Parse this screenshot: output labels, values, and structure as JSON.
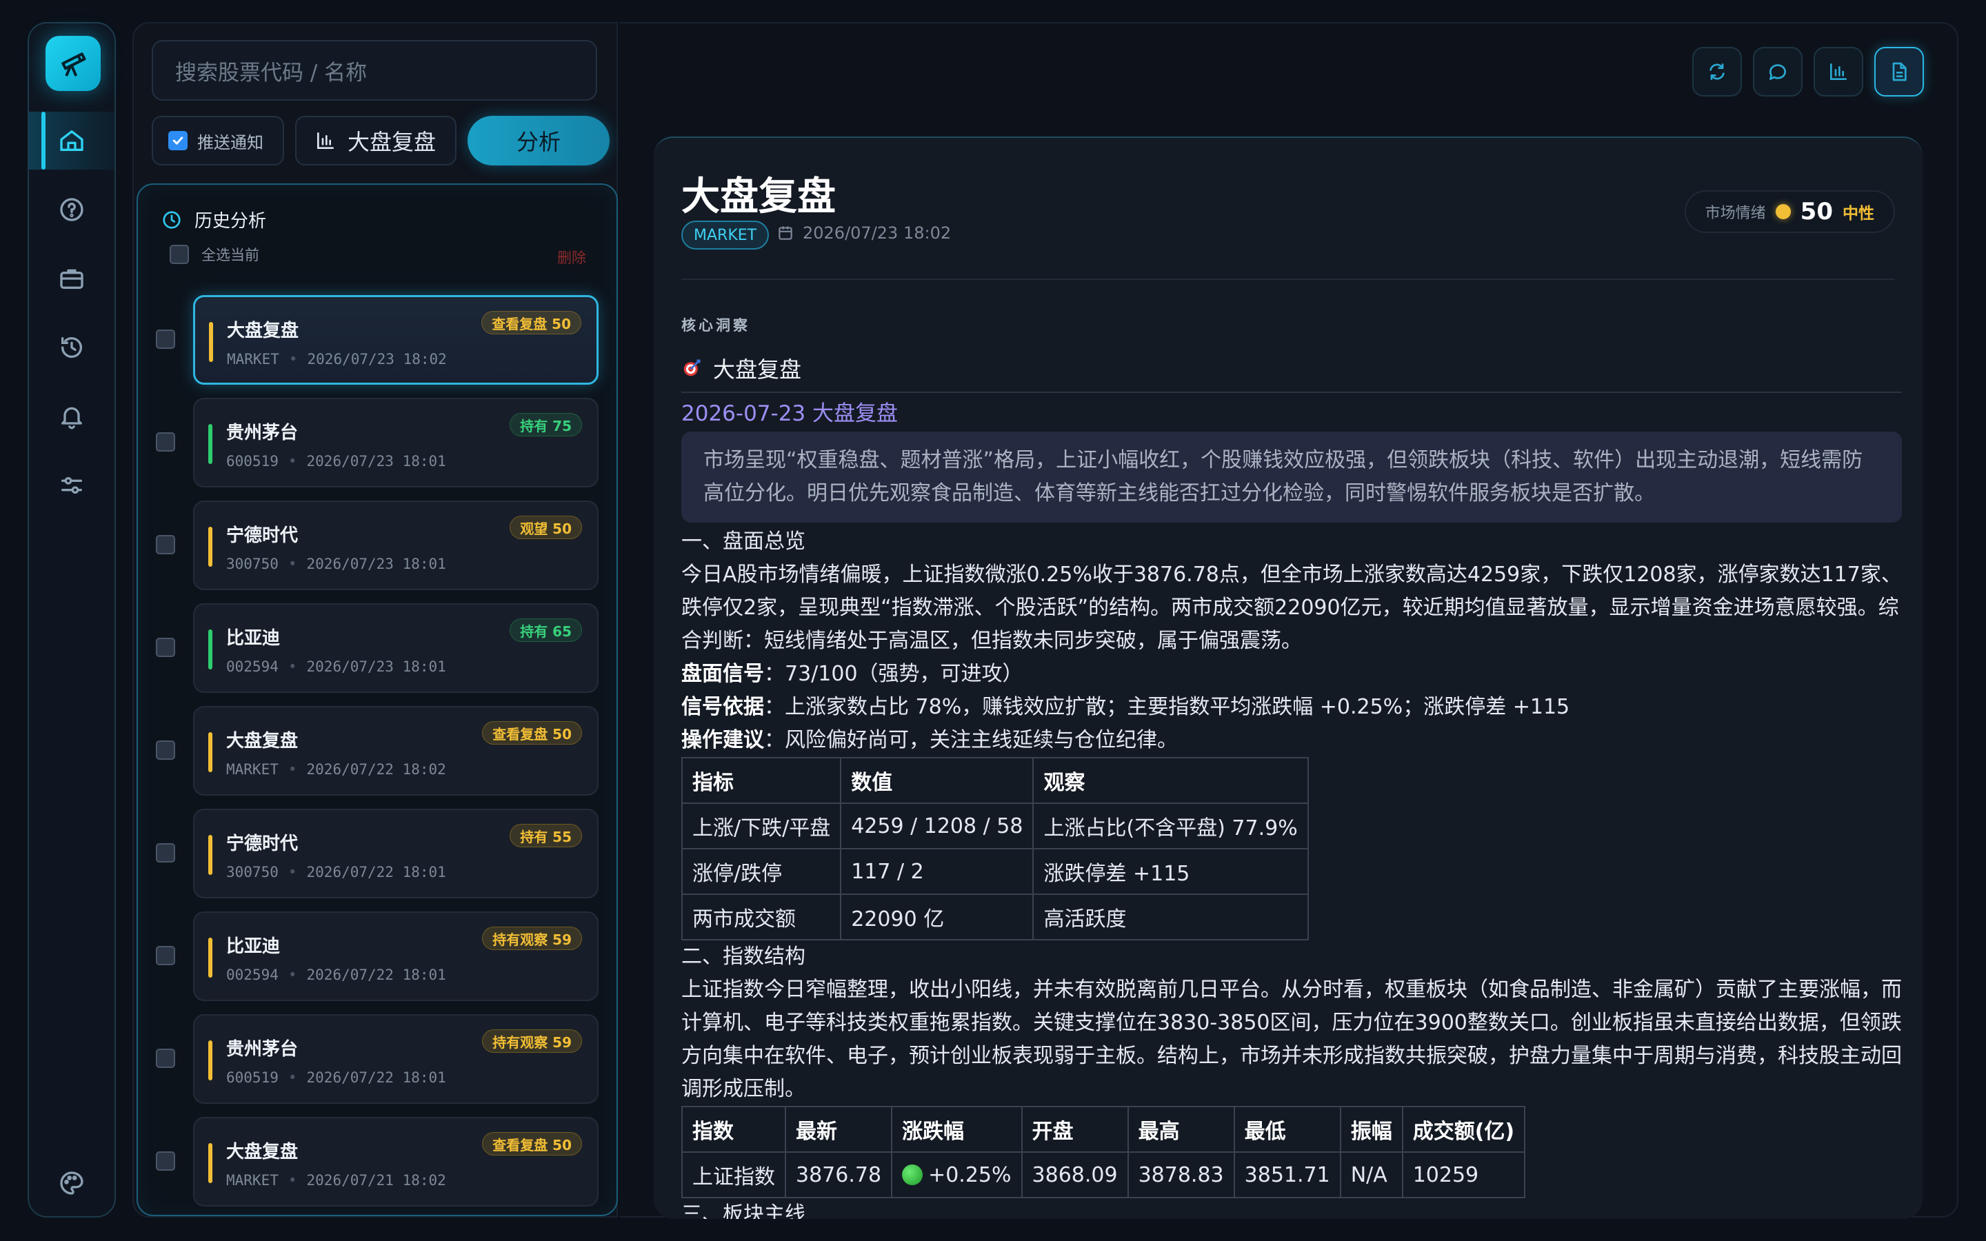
{
  "search": {
    "placeholder": "搜索股票代码 / 名称"
  },
  "controls": {
    "notify_label": "推送通知",
    "mode_label": "大盘复盘",
    "analyze_label": "分析"
  },
  "history": {
    "title": "历史分析",
    "select_all": "全选当前",
    "delete": "删除",
    "items": [
      {
        "name": "大盘复盘",
        "code": "MARKET",
        "time": "2026/07/23 18:02",
        "badge": "查看复盘 50",
        "color": "#f2be35",
        "tone": "yellow"
      },
      {
        "name": "贵州茅台",
        "code": "600519",
        "time": "2026/07/23 18:01",
        "badge": "持有 75",
        "color": "#2ecc6f",
        "tone": "green"
      },
      {
        "name": "宁德时代",
        "code": "300750",
        "time": "2026/07/23 18:01",
        "badge": "观望 50",
        "color": "#f2be35",
        "tone": "yellow"
      },
      {
        "name": "比亚迪",
        "code": "002594",
        "time": "2026/07/23 18:01",
        "badge": "持有 65",
        "color": "#2ecc6f",
        "tone": "green"
      },
      {
        "name": "大盘复盘",
        "code": "MARKET",
        "time": "2026/07/22 18:02",
        "badge": "查看复盘 50",
        "color": "#f2be35",
        "tone": "yellow"
      },
      {
        "name": "宁德时代",
        "code": "300750",
        "time": "2026/07/22 18:01",
        "badge": "持有 55",
        "color": "#f2be35",
        "tone": "yellow"
      },
      {
        "name": "比亚迪",
        "code": "002594",
        "time": "2026/07/22 18:01",
        "badge": "持有观察 59",
        "color": "#f2be35",
        "tone": "yellow"
      },
      {
        "name": "贵州茅台",
        "code": "600519",
        "time": "2026/07/22 18:01",
        "badge": "持有观察 59",
        "color": "#f2be35",
        "tone": "yellow"
      },
      {
        "name": "大盘复盘",
        "code": "MARKET",
        "time": "2026/07/21 18:02",
        "badge": "查看复盘 50",
        "color": "#f2be35",
        "tone": "yellow"
      }
    ]
  },
  "report": {
    "title": "大盘复盘",
    "tag": "MARKET",
    "date": "2026/07/23 18:02",
    "sentiment_label": "市场情绪",
    "sentiment_value": "50",
    "sentiment_text": "中性",
    "core_caption": "核心洞察",
    "heading": "大盘复盘",
    "date_heading": "2026-07-23 大盘复盘",
    "quote": "市场呈现“权重稳盘、题材普涨”格局，上证小幅收红，个股赚钱效应极强，但领跌板块（科技、软件）出现主动退潮，短线需防高位分化。明日优先观察食品制造、体育等新主线能否扛过分化检验，同时警惕软件服务板块是否扩散。",
    "s1_title": "一、盘面总览",
    "s1_body": "今日A股市场情绪偏暖，上证指数微涨0.25%收于3876.78点，但全市场上涨家数高达4259家，下跌仅1208家，涨停家数达117家、跌停仅2家，呈现典型“指数滞涨、个股活跃”的结构。两市成交额22090亿元，较近期均值显著放量，显示增量资金进场意愿较强。综合判断：短线情绪处于高温区，但指数未同步突破，属于偏强震荡。",
    "signal_label": "盘面信号",
    "signal_value": "：73/100（强势，可进攻）",
    "basis_label": "信号依据",
    "basis_value": "：上涨家数占比 78%，赚钱效应扩散；主要指数平均涨跌幅 +0.25%；涨跌停差 +115",
    "advice_label": "操作建议",
    "advice_value": "：风险偏好尚可，关注主线延续与仓位纪律。",
    "table1": {
      "headers": [
        "指标",
        "数值",
        "观察"
      ],
      "rows": [
        [
          "上涨/下跌/平盘",
          "4259 / 1208 / 58",
          "上涨占比(不含平盘) 77.9%"
        ],
        [
          "涨停/跌停",
          "117 / 2",
          "涨跌停差 +115"
        ],
        [
          "两市成交额",
          "22090 亿",
          "高活跃度"
        ]
      ]
    },
    "s2_title": "二、指数结构",
    "s2_body": "上证指数今日窄幅整理，收出小阳线，并未有效脱离前几日平台。从分时看，权重板块（如食品制造、非金属矿）贡献了主要涨幅，而计算机、电子等科技类权重拖累指数。关键支撑位在3830-3850区间，压力位在3900整数关口。创业板指虽未直接给出数据，但领跌方向集中在软件、电子，预计创业板表现弱于主板。结构上，市场并未形成指数共振突破，护盘力量集中于周期与消费，科技股主动回调形成压制。",
    "table2": {
      "headers": [
        "指数",
        "最新",
        "涨跌幅",
        "开盘",
        "最高",
        "最低",
        "振幅",
        "成交额(亿)"
      ],
      "rows": [
        [
          "上证指数",
          "3876.78",
          "+0.25%",
          "3868.09",
          "3878.83",
          "3851.71",
          "N/A",
          "10259"
        ]
      ]
    },
    "s3_title": "三、板块主线"
  },
  "colors": {
    "accent": "#22c8ec",
    "yellow": "#f2be35",
    "green": "#2ecc6f",
    "purple": "#9d8ff5"
  }
}
